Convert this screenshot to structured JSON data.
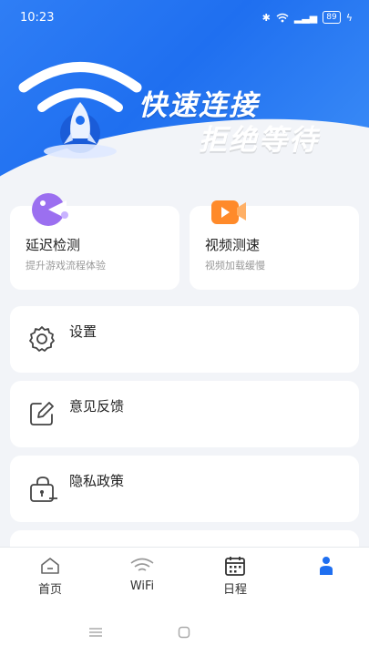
{
  "status_bar": {
    "time": "10:23",
    "battery": "89"
  },
  "banner": {
    "line1": "快速连接",
    "line2": "拒绝等待"
  },
  "features": [
    {
      "title": "延迟检测",
      "subtitle": "提升游戏流程体验",
      "icon": "gamepad-icon",
      "color": "#9b6ff0"
    },
    {
      "title": "视频测速",
      "subtitle": "视频加载缓慢",
      "icon": "video-icon",
      "color": "#ff8a2a"
    }
  ],
  "menu": [
    {
      "label": "设置",
      "icon": "gear-icon"
    },
    {
      "label": "意见反馈",
      "icon": "edit-icon"
    },
    {
      "label": "隐私政策",
      "icon": "lock-icon"
    }
  ],
  "nav": [
    {
      "label": "首页",
      "icon": "home-icon"
    },
    {
      "label": "WiFi",
      "icon": "wifi-icon"
    },
    {
      "label": "日程",
      "icon": "calendar-icon"
    },
    {
      "label": "",
      "icon": "profile-icon"
    }
  ],
  "colors": {
    "brand_blue": "#1f6ff0",
    "background": "#f2f4f8"
  }
}
